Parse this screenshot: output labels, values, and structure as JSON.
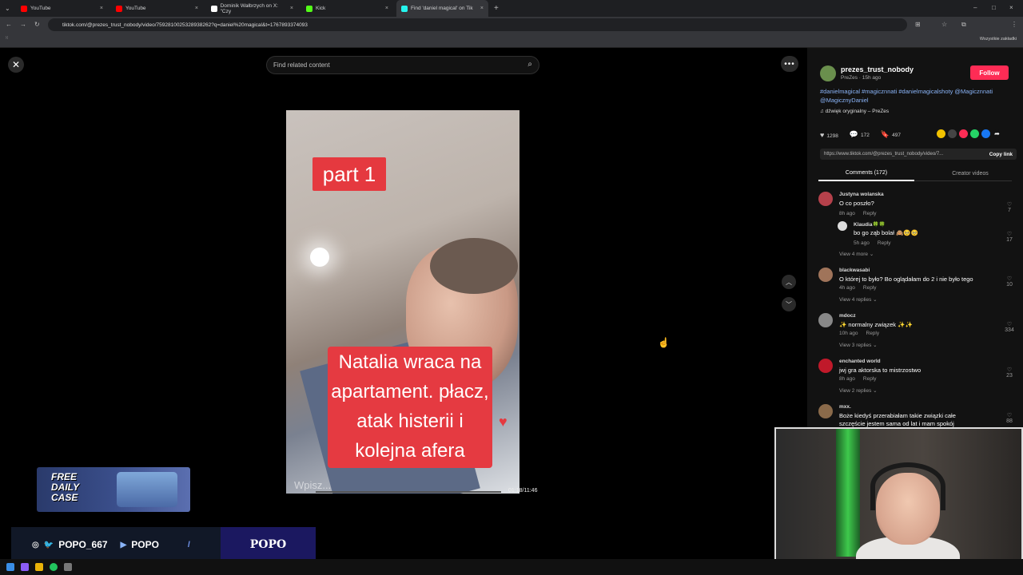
{
  "browser": {
    "tabs": [
      {
        "title": "YouTube",
        "color": "#ff0000"
      },
      {
        "title": "YouTube",
        "color": "#ff0000"
      },
      {
        "title": "Dominik Wałbrzych on X: \"Czy",
        "color": "#ffffff"
      },
      {
        "title": "Kick",
        "color": "#53fc18"
      },
      {
        "title": "Find 'daniel magical' on Tik",
        "color": "#25f4ee"
      }
    ],
    "url": "tiktok.com/@prezes_trust_nobody/video/7592810025328938262?q=daniel%20magical&t=1767893374093",
    "bookmarks_label": "Wszystkie zakładki"
  },
  "player": {
    "search_placeholder": "Find related content",
    "part_label": "part 1",
    "caption": "Natalia wraca na apartament. płacz, atak histerii i kolejna afera",
    "comment_hint": "Wpisz...",
    "time": "01:18/11:46",
    "progress_fraction": 0.0
  },
  "author": {
    "username": "prezes_trust_nobody",
    "subline": "PreZes · 15h ago",
    "follow_label": "Follow",
    "description": "#danielmagical #magicznnati #danielmagicalshoty @Magicznnati @MagicznyDaniel",
    "sound": "♫ dźwięk oryginalny – PreZes"
  },
  "stats": {
    "likes": "1298",
    "comments": "172",
    "saves": "497"
  },
  "link": {
    "url": "https://www.tiktok.com/@prezes_trust_nobody/video/7...",
    "copy_label": "Copy link"
  },
  "tabs": {
    "comments_label": "Comments (172)",
    "creator_label": "Creator videos"
  },
  "comments": [
    {
      "name": "Justyna wolanska",
      "text": "O co poszło?",
      "time": "8h ago",
      "reply": "Reply",
      "likes": "7",
      "color": "#b5414b"
    },
    {
      "name": "Klaudia🍀🍀",
      "text": "bo go ząb bolał 🙈🥺🥺",
      "time": "5h ago",
      "reply": "Reply",
      "likes": "17",
      "color": "#dddddd"
    },
    {
      "view": "View 4 more"
    },
    {
      "name": "blackwasabi",
      "text": "O której to było? Bo oglądałam do 2 i nie było tego",
      "time": "4h ago",
      "reply": "Reply",
      "likes": "10",
      "color": "#a0745a"
    },
    {
      "view": "View 4 replies"
    },
    {
      "name": "mdocz",
      "text": "✨ normalny związek ✨✨",
      "time": "10h ago",
      "reply": "Reply",
      "likes": "334",
      "color": "#888888"
    },
    {
      "view": "View 3 replies"
    },
    {
      "name": "enchanted world",
      "text": "jwj gra aktorska to mistrzostwo",
      "time": "8h ago",
      "reply": "Reply",
      "likes": "23",
      "color": "#c0192a"
    },
    {
      "view": "View 2 replies"
    },
    {
      "name": "mxx.",
      "text": "Boże kiedyś przerabiałam takie związki całe szczęście jestem sama od lat i mam spokój",
      "likes": "88",
      "color": "#8a6a4a"
    }
  ],
  "overlay": {
    "promo_text": "FREE DAILY CASE",
    "twitter_handle": "POPO_667",
    "youtube_handle": "POPO",
    "brand": "POPO"
  }
}
